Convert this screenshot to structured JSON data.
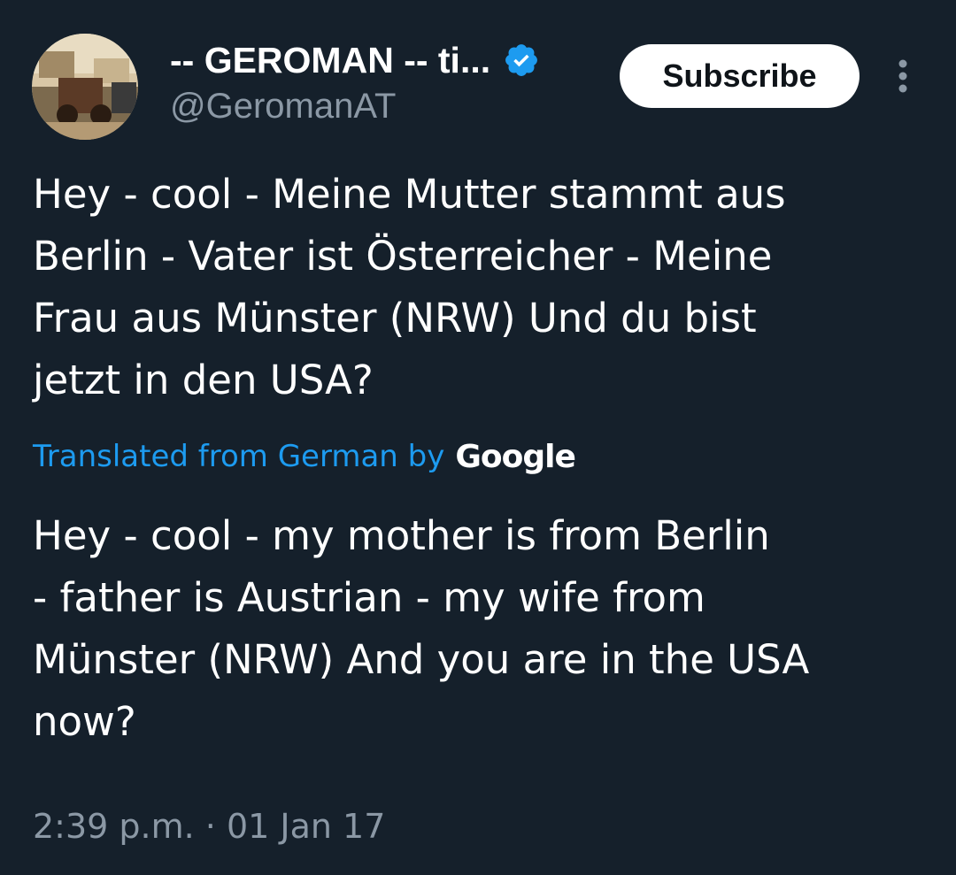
{
  "author": {
    "display_name": "-- GEROMAN -- ti...",
    "handle": "@GeromanAT",
    "verified": true,
    "avatar_icon": "profile-photo"
  },
  "actions": {
    "subscribe_label": "Subscribe",
    "more_icon": "more-vertical-icon"
  },
  "tweet": {
    "original_lines": [
      "Hey - cool - Meine Mutter stammt aus",
      "Berlin - Vater ist Österreicher - Meine",
      "Frau aus Münster (NRW) Und du bist",
      "jetzt in den USA?"
    ],
    "translation_label": "Translated from German by",
    "translation_provider": "Google",
    "translated_lines": [
      "Hey - cool - my mother is from Berlin",
      "- father is Austrian - my wife from",
      "Münster (NRW) And you are in the USA",
      "now?"
    ],
    "timestamp": "2:39 p.m. · 01 Jan 17"
  },
  "colors": {
    "background": "#15202b",
    "text_primary": "#ffffff",
    "text_secondary": "#8b98a5",
    "accent_blue": "#1d9bf0",
    "button_bg": "#ffffff",
    "button_text": "#0f1419"
  }
}
